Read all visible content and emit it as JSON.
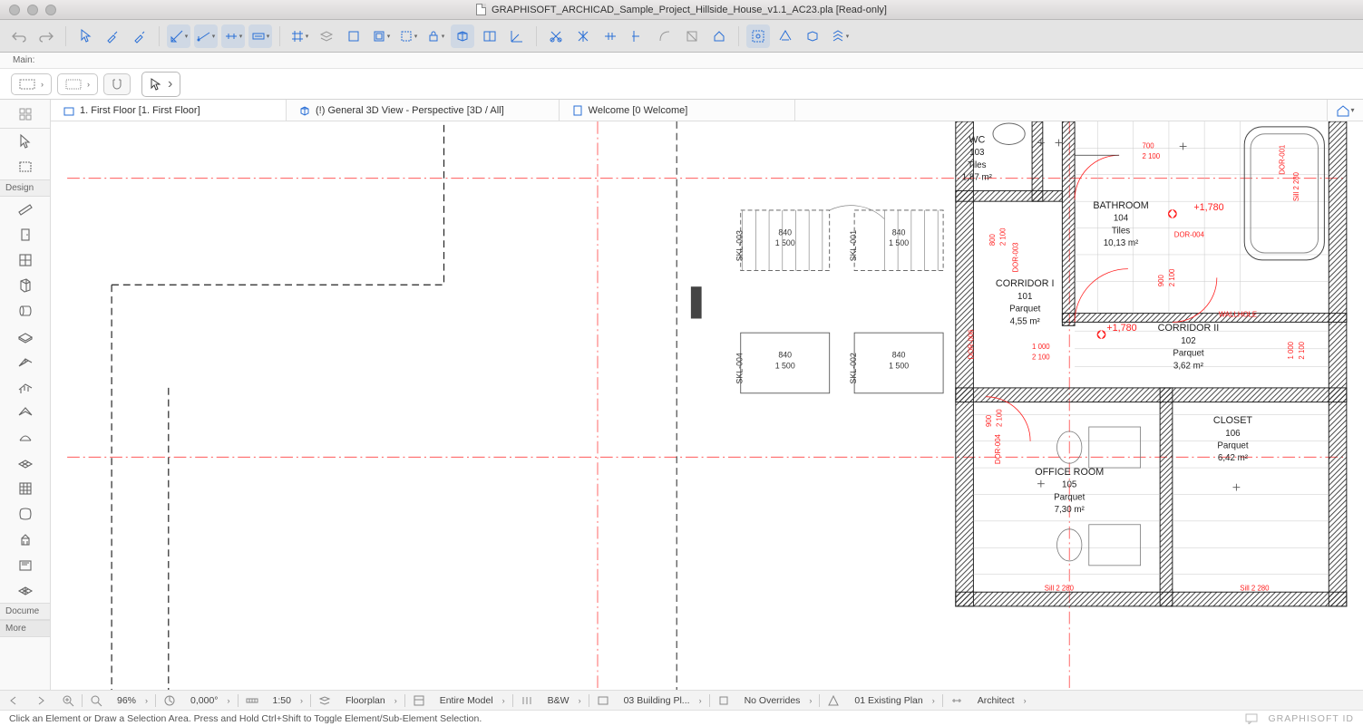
{
  "window": {
    "title": "GRAPHISOFT_ARCHICAD_Sample_Project_Hillside_House_v1.1_AC23.pla [Read-only]"
  },
  "rowlabel": "Main:",
  "tabs": [
    {
      "label": "1. First Floor [1. First Floor]"
    },
    {
      "label": "(!) General 3D View - Perspective [3D / All]"
    },
    {
      "label": "Welcome [0 Welcome]"
    }
  ],
  "sidebar": {
    "sections": {
      "design": "Design",
      "docume": "Docume",
      "more": "More"
    }
  },
  "rooms": {
    "wc": {
      "name": "WC",
      "num": "103",
      "mat": "Tiles",
      "area": "1,87 m²"
    },
    "bath": {
      "name": "BATHROOM",
      "num": "104",
      "mat": "Tiles",
      "area": "10,13 m²"
    },
    "corr1": {
      "name": "CORRIDOR I",
      "num": "101",
      "mat": "Parquet",
      "area": "4,55 m²"
    },
    "corr2": {
      "name": "CORRIDOR II",
      "num": "102",
      "mat": "Parquet",
      "area": "3,62 m²"
    },
    "office": {
      "name": "OFFICE ROOM",
      "num": "105",
      "mat": "Parquet",
      "area": "7,30 m²"
    },
    "closet": {
      "name": "CLOSET",
      "num": "106",
      "mat": "Parquet",
      "area": "6,42 m²"
    }
  },
  "skl": {
    "a": {
      "id": "SKL-003",
      "w": "840",
      "h": "1 500"
    },
    "b": {
      "id": "SKL-001",
      "w": "840",
      "h": "1 500"
    },
    "c": {
      "id": "SKL-004",
      "w": "840",
      "h": "1 500"
    },
    "d": {
      "id": "SKL-002",
      "w": "840",
      "h": "1 500"
    }
  },
  "doors": {
    "d1": "DOR-001",
    "d3": "DOR-003",
    "d4": "DOR-004",
    "d4b": "DOR-004",
    "d6": "DOR-006"
  },
  "dims": {
    "d800": "800",
    "d2100": "2 100",
    "d700": "700",
    "d900": "900",
    "d1000": "1 000",
    "sill2280": "Sill 2 280",
    "sill2280b": "Sill 2 280",
    "elev1780a": "+1,780",
    "elev1780b": "+1,780",
    "wallhole": "WALLHOLE"
  },
  "quicknav": {
    "zoom": "96%",
    "angle": "0,000°",
    "scale": "1:50",
    "layer": "Floorplan",
    "model": "Entire Model",
    "pen": "B&W",
    "building": "03 Building Pl...",
    "overrides": "No Overrides",
    "plan": "01 Existing Plan",
    "role": "Architect"
  },
  "status": {
    "hint": "Click an Element or Draw a Selection Area. Press and Hold Ctrl+Shift to Toggle Element/Sub-Element Selection.",
    "brand": "GRAPHISOFT ID"
  }
}
